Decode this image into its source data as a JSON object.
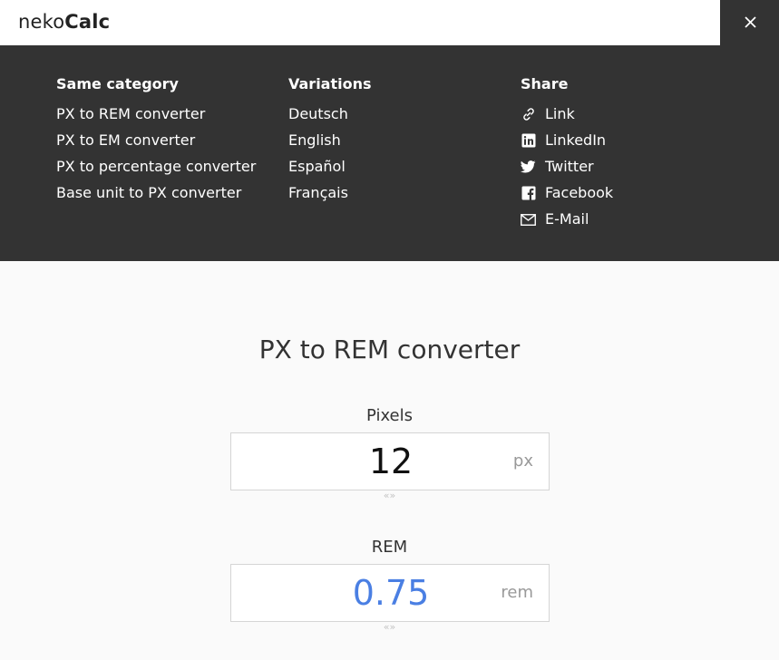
{
  "header": {
    "logo_light": "neko",
    "logo_bold": "Calc",
    "close_label": "×"
  },
  "menu": {
    "same_category": {
      "title": "Same category",
      "items": [
        "PX to REM converter",
        "PX to EM converter",
        "PX to percentage converter",
        "Base unit to PX converter"
      ]
    },
    "variations": {
      "title": "Variations",
      "items": [
        "Deutsch",
        "English",
        "Español",
        "Français"
      ]
    },
    "share": {
      "title": "Share",
      "items": [
        {
          "label": "Link",
          "icon": "link-icon"
        },
        {
          "label": "LinkedIn",
          "icon": "linkedin-icon"
        },
        {
          "label": "Twitter",
          "icon": "twitter-icon"
        },
        {
          "label": "Facebook",
          "icon": "facebook-icon"
        },
        {
          "label": "E-Mail",
          "icon": "email-icon"
        }
      ]
    }
  },
  "converter": {
    "title": "PX to REM converter",
    "pixels": {
      "label": "Pixels",
      "value": "12",
      "unit": "px"
    },
    "rem": {
      "label": "REM",
      "value": "0.75",
      "unit": "rem"
    },
    "swap_glyph": "«»"
  },
  "colors": {
    "menu_bg": "#333333",
    "result_text": "#4a7fe3"
  }
}
